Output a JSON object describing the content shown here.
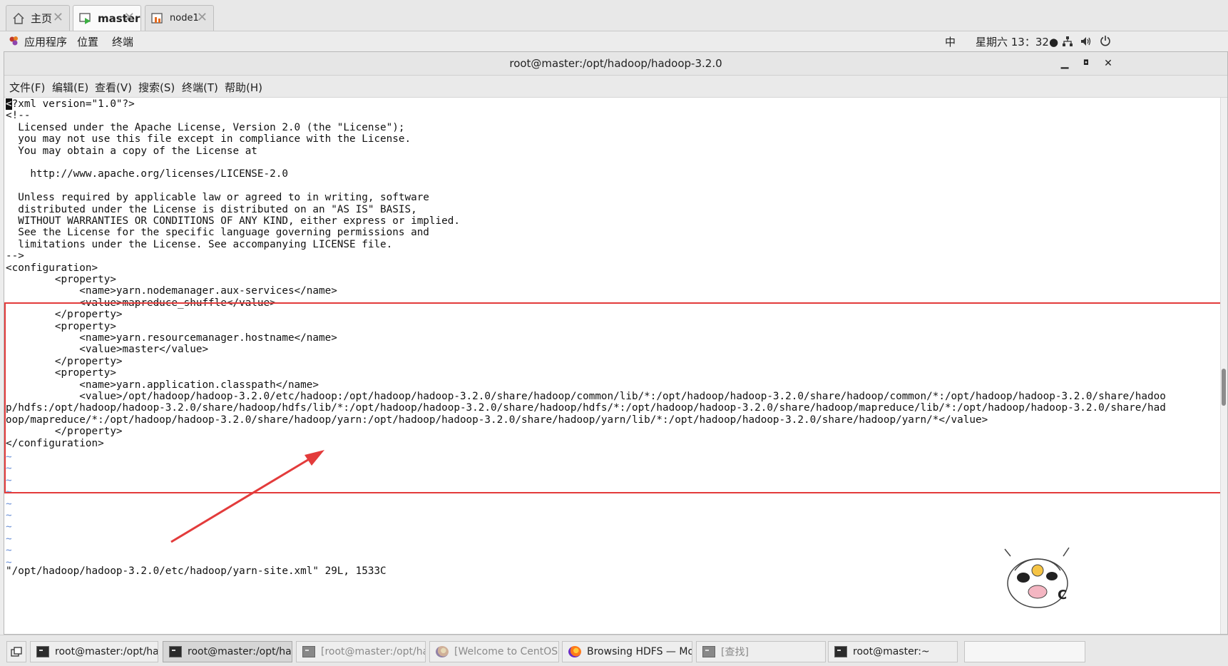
{
  "tabs": [
    {
      "label": "主页",
      "icon": "home-icon"
    },
    {
      "label": "master",
      "icon": "vm-running-icon"
    },
    {
      "label": "node1",
      "icon": "vm-icon"
    }
  ],
  "panel": {
    "applications": "应用程序",
    "places": "位置",
    "terminal": "终端",
    "input_method": "中",
    "clock": "星期六 13：32●"
  },
  "window": {
    "title": "root@master:/opt/hadoop/hadoop-3.2.0",
    "menu": [
      "文件(F)",
      "编辑(E)",
      "查看(V)",
      "搜索(S)",
      "终端(T)",
      "帮助(H)"
    ]
  },
  "editor": {
    "cursor_char": "<",
    "first_line_rest": "?xml version=\"1.0\"?>",
    "lines": [
      "<!--",
      "  Licensed under the Apache License, Version 2.0 (the \"License\");",
      "  you may not use this file except in compliance with the License.",
      "  You may obtain a copy of the License at",
      "",
      "    http://www.apache.org/licenses/LICENSE-2.0",
      "",
      "  Unless required by applicable law or agreed to in writing, software",
      "  distributed under the License is distributed on an \"AS IS\" BASIS,",
      "  WITHOUT WARRANTIES OR CONDITIONS OF ANY KIND, either express or implied.",
      "  See the License for the specific language governing permissions and",
      "  limitations under the License. See accompanying LICENSE file.",
      "-->",
      "<configuration>",
      "        <property>",
      "            <name>yarn.nodemanager.aux-services</name>",
      "            <value>mapreduce_shuffle</value>",
      "        </property>",
      "        <property>",
      "            <name>yarn.resourcemanager.hostname</name>",
      "            <value>master</value>",
      "        </property>",
      "        <property>",
      "            <name>yarn.application.classpath</name>",
      "            <value>/opt/hadoop/hadoop-3.2.0/etc/hadoop:/opt/hadoop/hadoop-3.2.0/share/hadoop/common/lib/*:/opt/hadoop/hadoop-3.2.0/share/hadoop/common/*:/opt/hadoop/hadoop-3.2.0/share/hadoo",
      "p/hdfs:/opt/hadoop/hadoop-3.2.0/share/hadoop/hdfs/lib/*:/opt/hadoop/hadoop-3.2.0/share/hadoop/hdfs/*:/opt/hadoop/hadoop-3.2.0/share/hadoop/mapreduce/lib/*:/opt/hadoop/hadoop-3.2.0/share/had",
      "oop/mapreduce/*:/opt/hadoop/hadoop-3.2.0/share/hadoop/yarn:/opt/hadoop/hadoop-3.2.0/share/hadoop/yarn/lib/*:/opt/hadoop/hadoop-3.2.0/share/hadoop/yarn/*</value>",
      "        </property>",
      "</configuration>"
    ],
    "tildes": [
      "~",
      "~",
      "~",
      "~",
      "~",
      "~",
      "~",
      "~",
      "~",
      "~"
    ],
    "status": "\"/opt/hadoop/hadoop-3.2.0/etc/hadoop/yarn-site.xml\" 29L, 1533C"
  },
  "annotation": {
    "box_color": "#e33b3b",
    "arrow_color": "#e33b3b"
  },
  "taskbar": [
    {
      "label": "root@master:/opt/hado···",
      "icon": "terminal-icon"
    },
    {
      "label": "root@master:/opt/hado···",
      "icon": "terminal-icon"
    },
    {
      "label": "[root@master:/opt/hado···",
      "icon": "terminal-icon"
    },
    {
      "label": "[Welcome to CentOS — ···",
      "icon": "firefox-icon"
    },
    {
      "label": "Browsing HDFS — Mozil···",
      "icon": "firefox-icon"
    },
    {
      "label": "[查找]",
      "icon": "terminal-icon"
    },
    {
      "label": "root@master:~",
      "icon": "terminal-icon"
    }
  ]
}
